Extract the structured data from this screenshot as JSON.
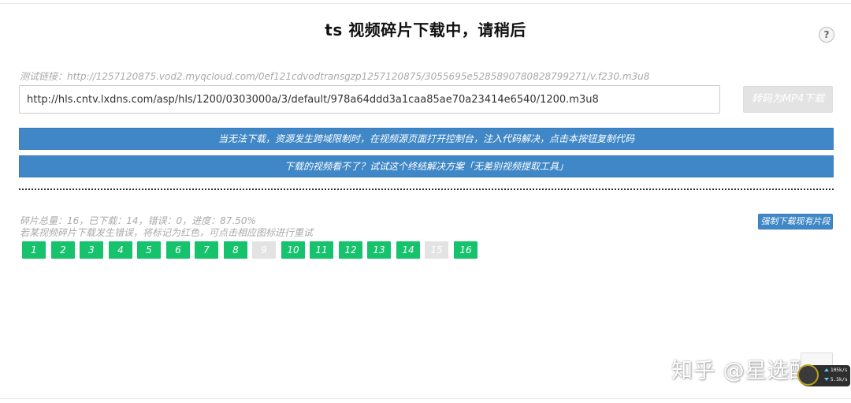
{
  "header": {
    "title": "ts 视频碎片下载中，请稍后",
    "help_glyph": "?"
  },
  "form": {
    "test_link": "测试链接：http://1257120875.vod2.myqcloud.com/0ef121cdvodtransgzp1257120875/3055695e5285890780828799271/v.f230.m3u8",
    "url_value": "http://hls.cntv.lxdns.com/asp/hls/1200/0303000a/3/default/978a64ddd3a1caa85ae70a23414e6540/1200.m3u8",
    "convert_label": "转码为MP4下载"
  },
  "actions": {
    "inject_code_label": "当无法下载，资源发生跨域限制时，在视频源页面打开控制台，注入代码解决，点击本按钮复制代码",
    "tool_label": "下载的视频看不了？试试这个终结解决方案「无差别视频提取工具」"
  },
  "status": {
    "progress_text": "碎片总量：16，已下载：14，错误：0，进度：87.50%",
    "hint_text": "若某视频碎片下载发生错误，将标记为红色，可点击相应图标进行重试",
    "force_download_label": "强制下载现有片段"
  },
  "segments": [
    {
      "label": "1",
      "status": "done"
    },
    {
      "label": "2",
      "status": "done"
    },
    {
      "label": "3",
      "status": "done"
    },
    {
      "label": "4",
      "status": "done"
    },
    {
      "label": "5",
      "status": "done"
    },
    {
      "label": "6",
      "status": "done"
    },
    {
      "label": "7",
      "status": "done"
    },
    {
      "label": "8",
      "status": "done"
    },
    {
      "label": "9",
      "status": "pending"
    },
    {
      "label": "10",
      "status": "done"
    },
    {
      "label": "11",
      "status": "done"
    },
    {
      "label": "12",
      "status": "done"
    },
    {
      "label": "13",
      "status": "done"
    },
    {
      "label": "14",
      "status": "done"
    },
    {
      "label": "15",
      "status": "pending"
    },
    {
      "label": "16",
      "status": "done"
    }
  ],
  "overlay": {
    "watermark": "知乎 @星选酷",
    "speed_up": "105k/s",
    "speed_down": "5.5k/s"
  },
  "colors": {
    "primary_blue": "#3f87c6",
    "segment_done": "#16c36c",
    "segment_pending": "#e3e3e3"
  }
}
